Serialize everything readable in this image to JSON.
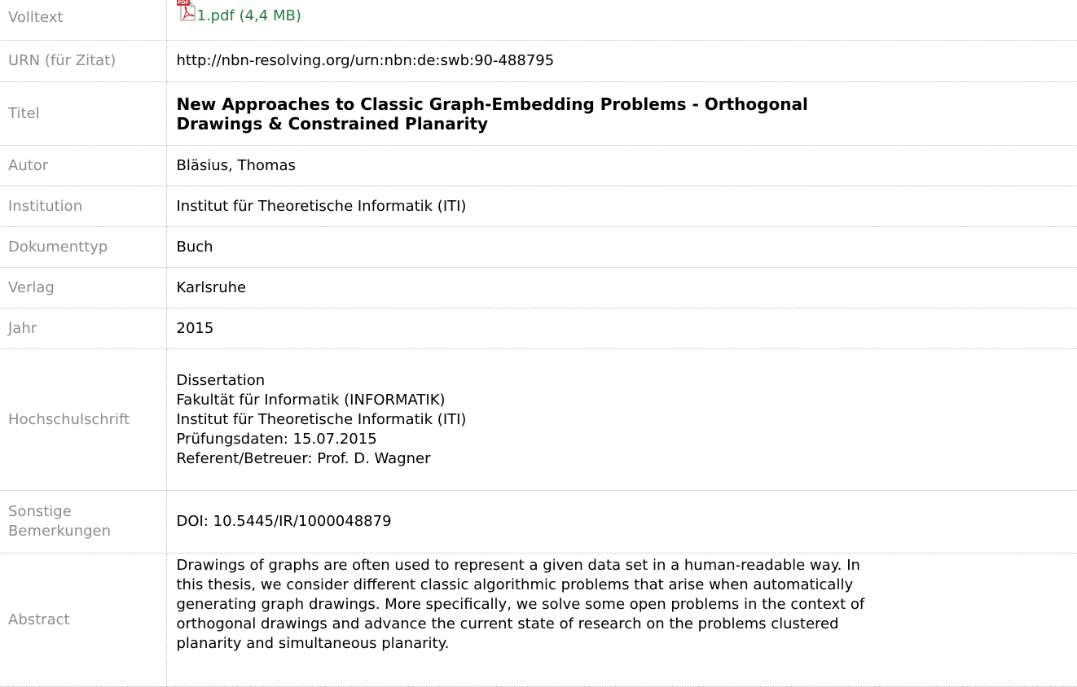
{
  "rows": {
    "volltext": {
      "label": "Volltext",
      "file_label": "1.pdf (4,4 MB)",
      "icon": "pdf-file-icon"
    },
    "urn": {
      "label": "URN (für Zitat)",
      "value": "http://nbn-resolving.org/urn:nbn:de:swb:90-488795"
    },
    "titel": {
      "label": "Titel",
      "value_line1": "New Approaches to Classic Graph-Embedding Problems - Orthogonal",
      "value_line2": "Drawings & Constrained Planarity"
    },
    "autor": {
      "label": "Autor",
      "value": "Bläsius, Thomas"
    },
    "institution": {
      "label": "Institution",
      "value": "Institut für Theoretische Informatik (ITI)"
    },
    "dokumenttyp": {
      "label": "Dokumenttyp",
      "value": "Buch"
    },
    "verlag": {
      "label": "Verlag",
      "value": "Karlsruhe"
    },
    "jahr": {
      "label": "Jahr",
      "value": "2015"
    },
    "hochschulschrift": {
      "label": "Hochschulschrift",
      "lines": [
        "Dissertation",
        "Fakultät für Informatik (INFORMATIK)",
        "Institut für Theoretische Informatik (ITI)",
        "Prüfungsdaten: 15.07.2015",
        "Referent/Betreuer: Prof. D. Wagner"
      ]
    },
    "sonstige": {
      "label_line1": "Sonstige",
      "label_line2": "Bemerkungen",
      "value": "DOI: 10.5445/IR/1000048879"
    },
    "abstract": {
      "label": "Abstract",
      "lines": [
        "Drawings of graphs are often used to represent a given data set in a human-readable way. In",
        "this thesis, we consider different classic algorithmic problems that arise when automatically",
        "generating graph drawings. More specifically, we solve some open problems in the context of",
        "orthogonal drawings and advance the current state of research on the problems clustered",
        "planarity and simultaneous planarity."
      ]
    }
  },
  "colors": {
    "label_text": "#8c8c8c",
    "link_text": "#1f7f3a",
    "pdf_icon_red": "#d42a2a",
    "row_separator": "#bdbdbd"
  }
}
